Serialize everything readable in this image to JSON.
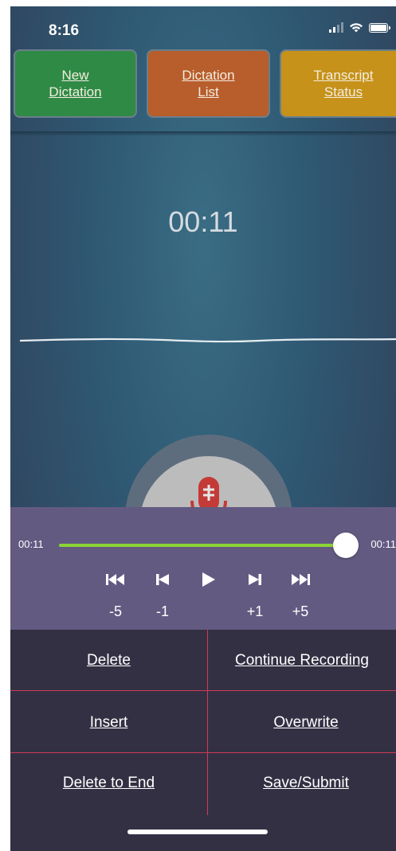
{
  "status_bar": {
    "time": "8:16"
  },
  "nav": {
    "new_dictation": "New\nDictation",
    "dictation_list": "Dictation\nList",
    "transcript_status": "Transcript\nStatus"
  },
  "recorder": {
    "timer": "00:11"
  },
  "player": {
    "elapsed": "00:11",
    "total": "00:11",
    "progress": 1.0,
    "controls": [
      {
        "icon": "skip-back-5-icon",
        "label": "-5"
      },
      {
        "icon": "skip-back-1-icon",
        "label": "-1"
      },
      {
        "icon": "play-icon",
        "label": ""
      },
      {
        "icon": "skip-forward-1-icon",
        "label": "+1"
      },
      {
        "icon": "skip-forward-5-icon",
        "label": "+5"
      }
    ]
  },
  "actions": {
    "delete": "Delete",
    "continue_recording": "Continue Recording",
    "insert": "Insert",
    "overwrite": "Overwrite",
    "delete_to_end": "Delete to End",
    "save_submit": "Save/Submit"
  },
  "colors": {
    "new_dictation": "#2f8a45",
    "dictation_list": "#b85d2c",
    "transcript_status": "#c6921a",
    "progress": "#8bd437",
    "player_bg": "#635a82",
    "actions_bg": "#343044",
    "divider": "#d03a54"
  }
}
